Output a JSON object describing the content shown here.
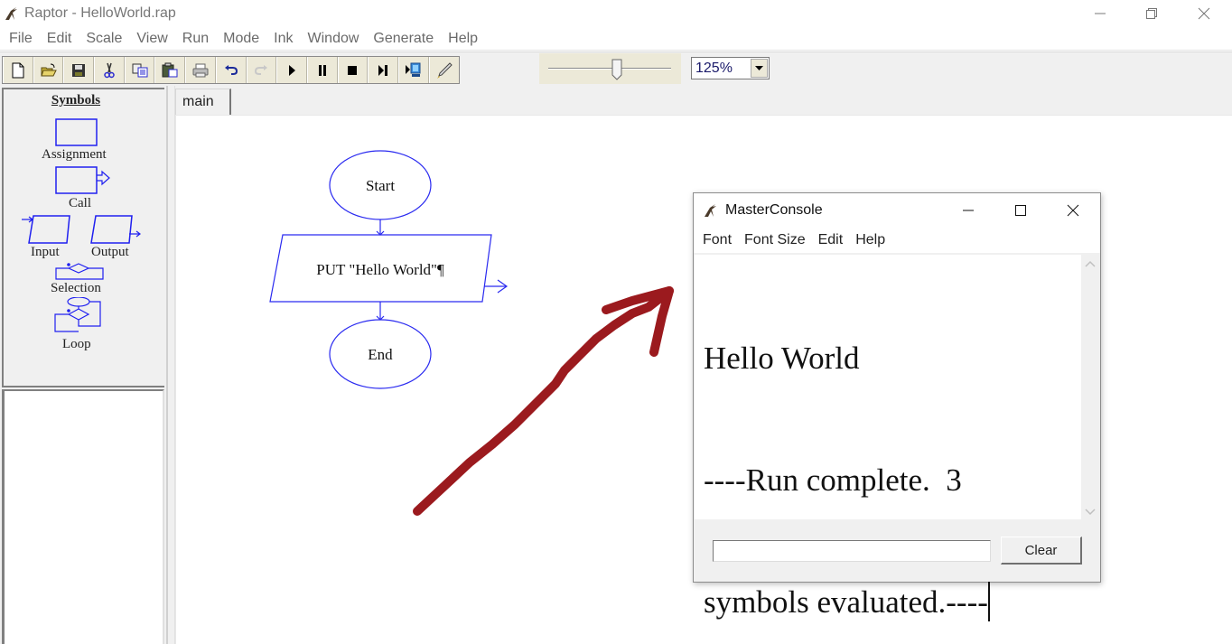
{
  "window": {
    "title": "Raptor - HelloWorld.rap",
    "controls": [
      "minimize",
      "restore",
      "close"
    ]
  },
  "menubar": {
    "items": [
      "File",
      "Edit",
      "Scale",
      "View",
      "Run",
      "Mode",
      "Ink",
      "Window",
      "Generate",
      "Help"
    ]
  },
  "toolbar": {
    "buttons": [
      {
        "name": "new",
        "icon": "new-file-icon",
        "enabled": true
      },
      {
        "name": "open",
        "icon": "open-folder-icon",
        "enabled": true
      },
      {
        "name": "save",
        "icon": "floppy-save-icon",
        "enabled": true
      },
      {
        "name": "cut",
        "icon": "scissors-icon",
        "enabled": true
      },
      {
        "name": "copy",
        "icon": "copy-icon",
        "enabled": true
      },
      {
        "name": "paste",
        "icon": "paste-icon",
        "enabled": true
      },
      {
        "name": "print",
        "icon": "printer-icon",
        "enabled": true
      },
      {
        "name": "undo",
        "icon": "undo-icon",
        "enabled": true
      },
      {
        "name": "redo",
        "icon": "redo-icon",
        "enabled": false
      },
      {
        "name": "execute",
        "icon": "play-icon",
        "enabled": true
      },
      {
        "name": "pause",
        "icon": "pause-icon",
        "enabled": true
      },
      {
        "name": "stop",
        "icon": "stop-icon",
        "enabled": true
      },
      {
        "name": "step",
        "icon": "step-icon",
        "enabled": true
      },
      {
        "name": "step-to-completion",
        "icon": "step-monitor-icon",
        "enabled": true
      },
      {
        "name": "ink-pen",
        "icon": "pen-icon",
        "enabled": true
      }
    ],
    "speed_slider": {
      "value_fraction": 0.56
    },
    "zoom": {
      "value": "125%"
    }
  },
  "symbols_panel": {
    "title": "Symbols",
    "symbols": [
      "Assignment",
      "Call",
      "Input",
      "Output",
      "Selection",
      "Loop"
    ]
  },
  "tabs": [
    {
      "label": "main",
      "active": true
    }
  ],
  "flowchart": {
    "start_label": "Start",
    "output_label": "PUT \"Hello World\"¶",
    "end_label": "End",
    "stroke_color": "#2a2af0"
  },
  "ink": {
    "color": "#9b1a1e"
  },
  "console": {
    "title": "MasterConsole",
    "menu": [
      "Font",
      "Font Size",
      "Edit",
      "Help"
    ],
    "output_lines": [
      "Hello World",
      "----Run complete.  3",
      "symbols evaluated.----"
    ],
    "input_value": "",
    "clear_label": "Clear"
  }
}
